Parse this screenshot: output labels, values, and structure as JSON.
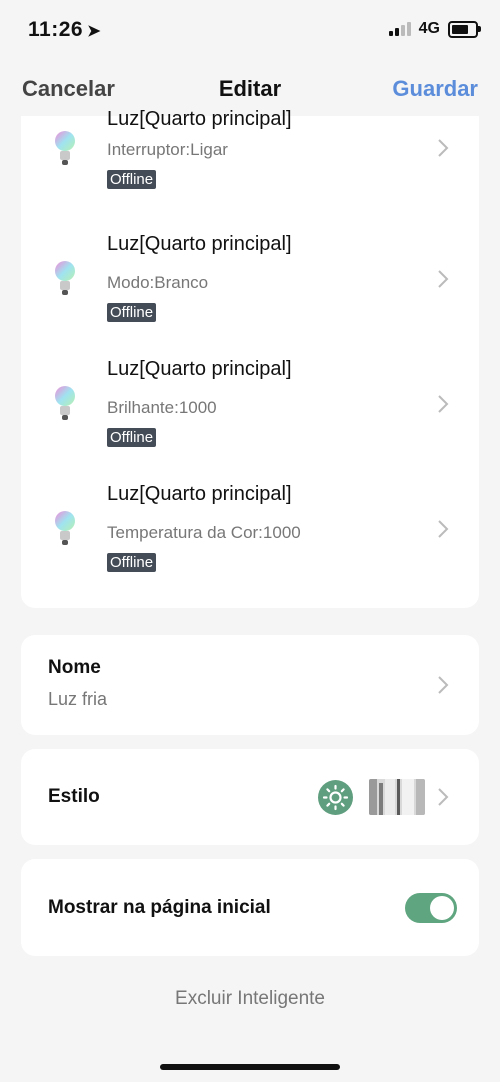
{
  "status_bar": {
    "time": "11:26",
    "network": "4G",
    "battery_fraction": 0.75,
    "signal_bars_on": 2,
    "signal_bars_total": 4
  },
  "nav": {
    "cancel": "Cancelar",
    "title": "Editar",
    "save": "Guardar"
  },
  "actions": [
    {
      "title": "Luz[Quarto principal]",
      "detail": "Interruptor:Ligar",
      "status": "Offline"
    },
    {
      "title": "Luz[Quarto principal]",
      "detail": "Modo:Branco",
      "status": "Offline"
    },
    {
      "title": "Luz[Quarto principal]",
      "detail": " Brilhante:1000",
      "status": "Offline"
    },
    {
      "title": "Luz[Quarto principal]",
      "detail": " Temperatura da Cor:1000",
      "status": "Offline"
    }
  ],
  "name_section": {
    "label": "Nome",
    "value": "Luz fria"
  },
  "style_section": {
    "label": "Estilo",
    "icon_color": "#5f9e7e"
  },
  "home_section": {
    "label": "Mostrar na página inicial",
    "toggle_on": true,
    "toggle_color": "#5fa57f"
  },
  "delete_label": "Excluir Inteligente"
}
